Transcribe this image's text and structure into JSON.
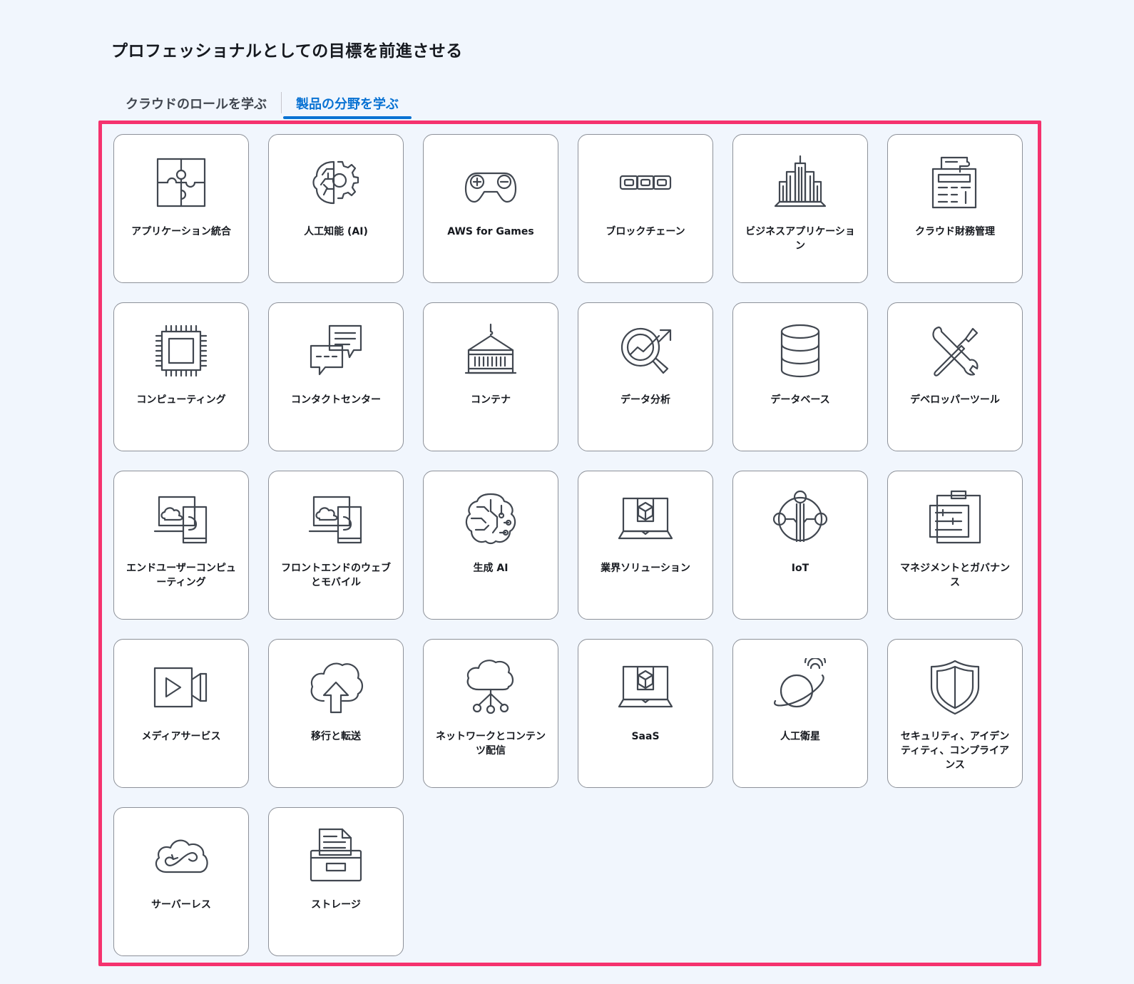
{
  "page": {
    "title": "プロフェッショナルとしての目標を前進させる"
  },
  "tabs": [
    {
      "label": "クラウドのロールを学ぶ",
      "active": false
    },
    {
      "label": "製品の分野を学ぶ",
      "active": true
    }
  ],
  "colors": {
    "accent": "#0972d3",
    "highlight": "#f5326e",
    "background": "#f1f6fd",
    "icon": "#414750"
  },
  "cards": [
    {
      "label": "アプリケーション統合",
      "icon": "puzzle-icon"
    },
    {
      "label": "人工知能 (AI)",
      "icon": "brain-gear-icon"
    },
    {
      "label": "AWS for Games",
      "icon": "gamepad-icon"
    },
    {
      "label": "ブロックチェーン",
      "icon": "chain-icon"
    },
    {
      "label": "ビジネスアプリケーション",
      "icon": "city-building-icon"
    },
    {
      "label": "クラウド財務管理",
      "icon": "calculator-receipt-icon"
    },
    {
      "label": "コンピューティング",
      "icon": "chip-icon"
    },
    {
      "label": "コンタクトセンター",
      "icon": "chat-bubbles-icon"
    },
    {
      "label": "コンテナ",
      "icon": "container-icon"
    },
    {
      "label": "データ分析",
      "icon": "analytics-magnifier-icon"
    },
    {
      "label": "データベース",
      "icon": "database-icon"
    },
    {
      "label": "デベロッパーツール",
      "icon": "wrench-screwdriver-icon"
    },
    {
      "label": "エンドユーザーコンピューティング",
      "icon": "laptop-cloud-icon"
    },
    {
      "label": "フロントエンドのウェブとモバイル",
      "icon": "laptop-cloud-mobile-icon"
    },
    {
      "label": "生成 AI",
      "icon": "brain-circuit-icon"
    },
    {
      "label": "業界ソリューション",
      "icon": "laptop-cube-icon"
    },
    {
      "label": "IoT",
      "icon": "iot-hub-icon"
    },
    {
      "label": "マネジメントとガバナンス",
      "icon": "clipboard-sliders-icon"
    },
    {
      "label": "メディアサービス",
      "icon": "video-camera-icon"
    },
    {
      "label": "移行と転送",
      "icon": "cloud-upload-icon"
    },
    {
      "label": "ネットワークとコンテンツ配信",
      "icon": "cloud-network-icon"
    },
    {
      "label": "SaaS",
      "icon": "laptop-cube-icon"
    },
    {
      "label": "人工衛星",
      "icon": "planet-satellite-icon"
    },
    {
      "label": "セキュリティ、アイデンティティ、コンプライアンス",
      "icon": "shield-icon"
    },
    {
      "label": "サーバーレス",
      "icon": "cloud-infinity-icon"
    },
    {
      "label": "ストレージ",
      "icon": "file-storage-icon"
    }
  ]
}
